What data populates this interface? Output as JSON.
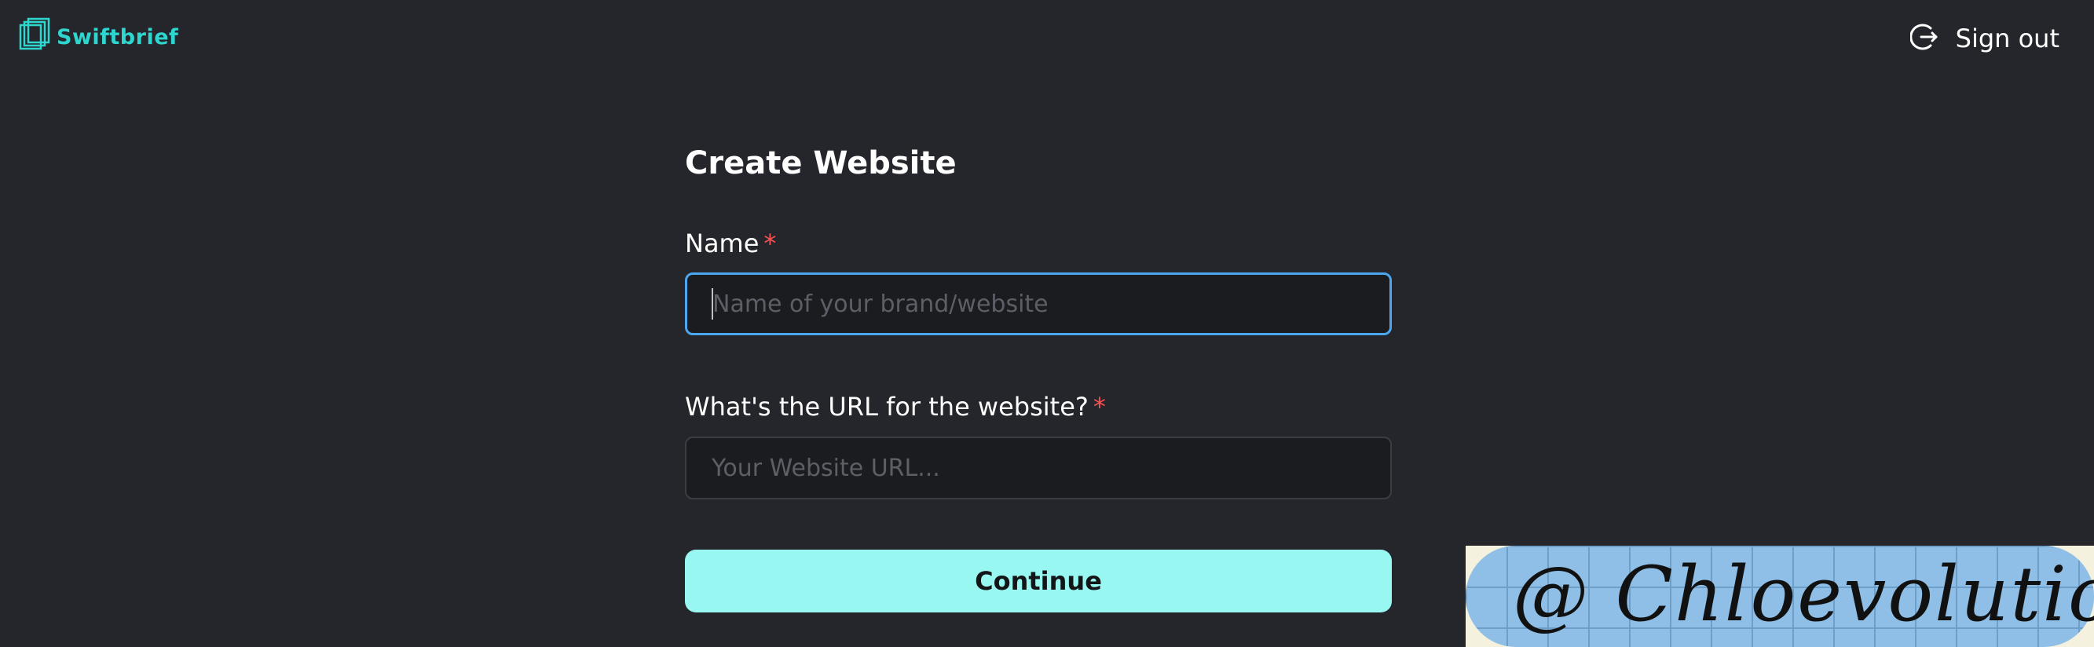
{
  "app": {
    "logo_text": "Swiftbrief",
    "logo_icon": "layered-squares-logo",
    "brand_color": "#2fd6d0"
  },
  "header": {
    "signout_label": "Sign out",
    "signout_icon": "logout-icon"
  },
  "form": {
    "title": "Create Website",
    "name_field": {
      "label": "Name",
      "required_mark": "*",
      "value": "",
      "placeholder": "Name of your brand/website"
    },
    "url_field": {
      "label": "What's the URL for the website?",
      "required_mark": "*",
      "value": "",
      "placeholder": "Your Website URL..."
    },
    "continue_label": "Continue"
  },
  "colors": {
    "background": "#25262b",
    "focus_border": "#4ca6f0",
    "button_bg": "#99f7f2",
    "required": "#fa5252"
  },
  "watermark": {
    "text": "@ Chloevolution"
  }
}
